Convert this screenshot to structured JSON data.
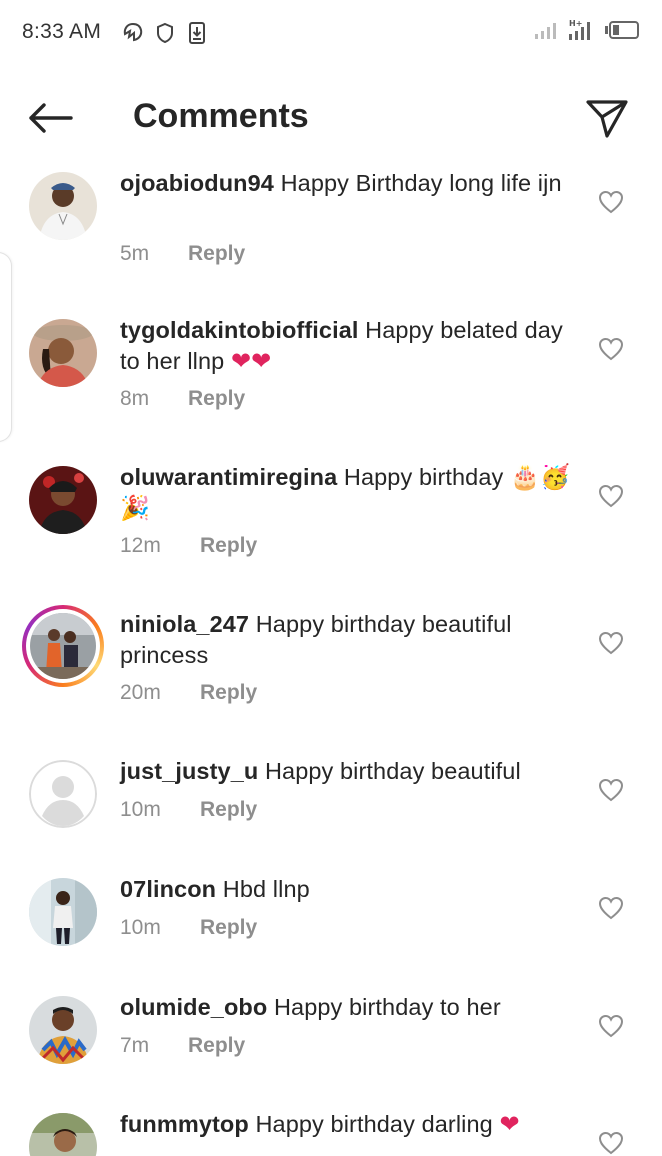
{
  "status_bar": {
    "time": "8:33 AM",
    "left_icons": [
      "app-notification-icon",
      "shield-icon",
      "download-icon"
    ],
    "right_icons": [
      "signal-icon",
      "signal-h-plus-icon",
      "battery-icon"
    ]
  },
  "header": {
    "title": "Comments",
    "back_icon": "back-arrow-icon",
    "send_icon": "send-icon"
  },
  "comments": [
    {
      "username": "ojoabiodun94",
      "text": " Happy Birthday long life ijn",
      "time": "5m",
      "reply": "Reply"
    },
    {
      "username": "tygoldakintobiofficial",
      "text": " Happy belated day to her llnp ",
      "emoji": "❤❤",
      "time": "8m",
      "reply": "Reply"
    },
    {
      "username": "oluwarantimiregina",
      "text": " Happy birthday ",
      "emoji": "🎂🥳🎉",
      "time": "12m",
      "reply": "Reply"
    },
    {
      "username": "niniola_247",
      "text": " Happy birthday beautiful princess",
      "time": "20m",
      "reply": "Reply"
    },
    {
      "username": "just_justy_u",
      "text": " Happy birthday beautiful",
      "time": "10m",
      "reply": "Reply"
    },
    {
      "username": "07lincon",
      "text": " Hbd llnp",
      "time": "10m",
      "reply": "Reply"
    },
    {
      "username": "olumide_obo",
      "text": " Happy birthday to her",
      "time": "7m",
      "reply": "Reply"
    },
    {
      "username": "funmmytop",
      "text": " Happy birthday darling ",
      "emoji": "❤",
      "time": "",
      "reply": ""
    }
  ],
  "colors": {
    "text": "#262626",
    "secondary": "#8e8e8e",
    "heart_emoji": "#e0245e"
  }
}
